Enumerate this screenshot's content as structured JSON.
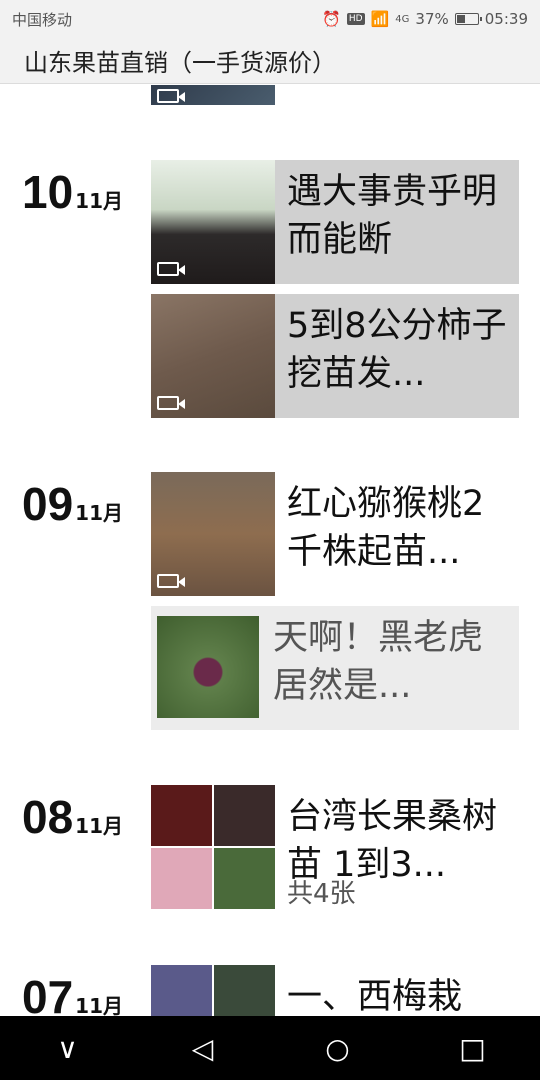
{
  "status_bar": {
    "carrier": "中国移动",
    "network": "4G",
    "battery": "37%",
    "time": "05:39"
  },
  "header": {
    "title": "山东果苗直销（一手货源价）"
  },
  "feed": [
    {
      "day": "10",
      "month": "11月",
      "posts": [
        {
          "text": "遇大事贵乎明而能断",
          "type": "video"
        },
        {
          "text": "5到8公分柿子挖苗发...",
          "type": "video"
        }
      ]
    },
    {
      "day": "09",
      "month": "11月",
      "posts": [
        {
          "text": "红心猕猴桃2千株起苗...",
          "type": "video"
        },
        {
          "text": "天啊！黑老虎居然是...",
          "type": "link"
        }
      ]
    },
    {
      "day": "08",
      "month": "11月",
      "posts": [
        {
          "text": "台湾长果桑树苗 1到3...",
          "type": "album",
          "count": "共4张"
        }
      ]
    },
    {
      "day": "07",
      "month": "11月",
      "posts": [
        {
          "text": "一、西梅栽",
          "type": "album"
        }
      ]
    }
  ],
  "nav": {
    "back": "◁",
    "home": "○",
    "recent": "□",
    "down": "∨"
  }
}
